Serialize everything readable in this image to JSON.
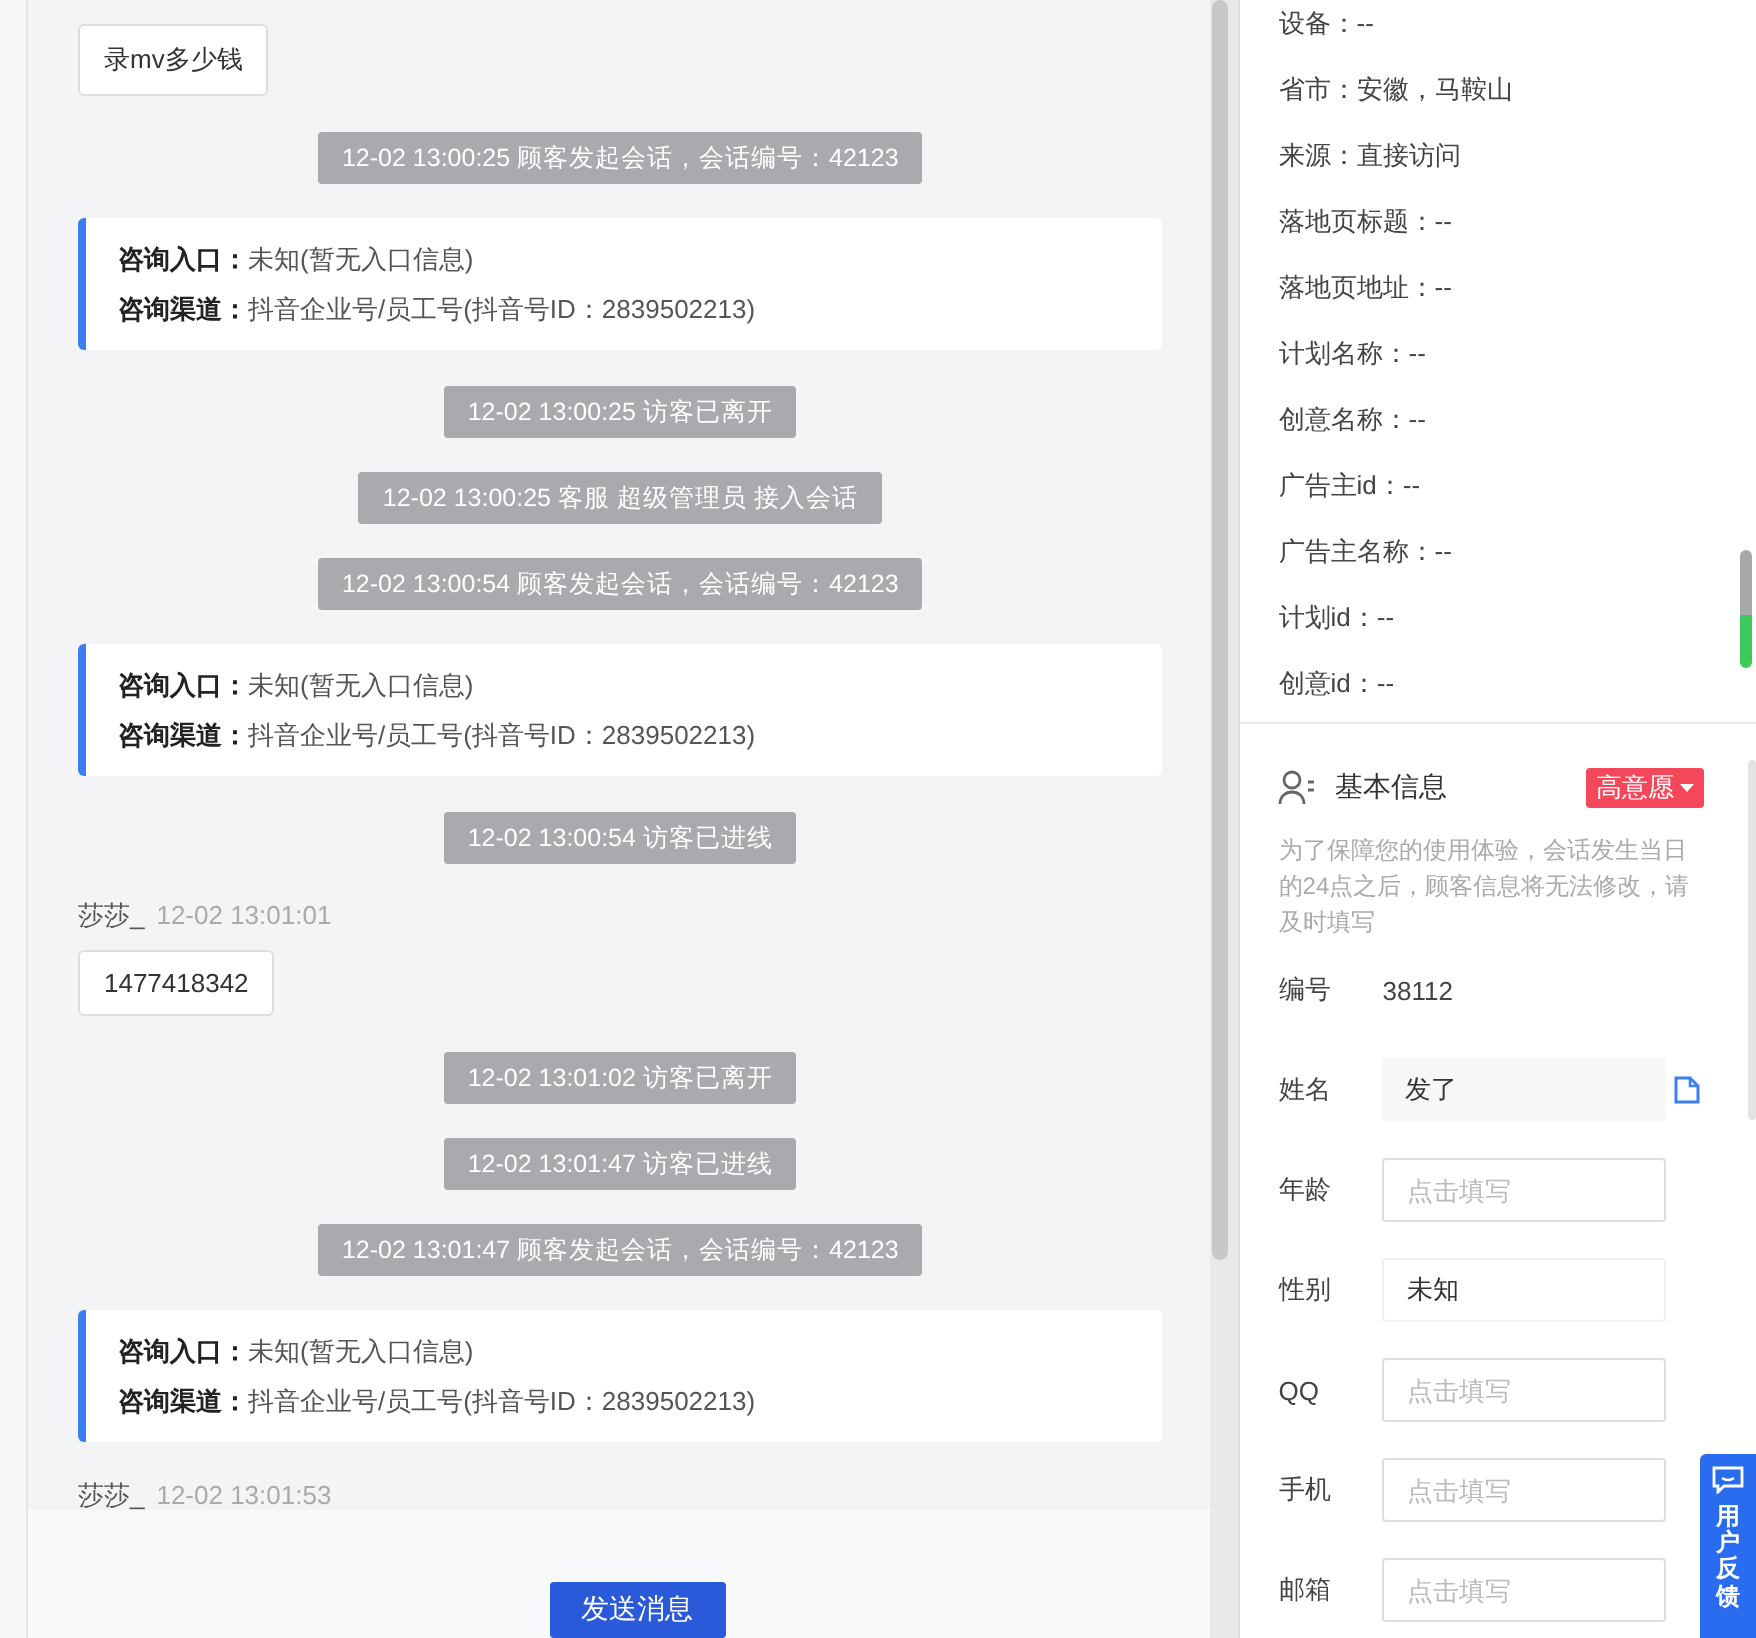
{
  "chat": {
    "items": [
      {
        "kind": "bubble",
        "text": "录mv多少钱"
      },
      {
        "kind": "system",
        "text": "12-02 13:00:25 顾客发起会话，会话编号：42123"
      },
      {
        "kind": "card",
        "lines": [
          {
            "label": "咨询入口：",
            "value": "未知(暂无入口信息)"
          },
          {
            "label": "咨询渠道：",
            "value": "抖音企业号/员工号(抖音号ID：2839502213)"
          }
        ]
      },
      {
        "kind": "system",
        "text": "12-02 13:00:25 访客已离开"
      },
      {
        "kind": "system",
        "text": "12-02 13:00:25 客服 超级管理员 接入会话"
      },
      {
        "kind": "system",
        "text": "12-02 13:00:54 顾客发起会话，会话编号：42123"
      },
      {
        "kind": "card",
        "lines": [
          {
            "label": "咨询入口：",
            "value": "未知(暂无入口信息)"
          },
          {
            "label": "咨询渠道：",
            "value": "抖音企业号/员工号(抖音号ID：2839502213)"
          }
        ]
      },
      {
        "kind": "system",
        "text": "12-02 13:00:54 访客已进线"
      },
      {
        "kind": "sender",
        "name": "莎莎_",
        "time": "12-02 13:01:01"
      },
      {
        "kind": "bubble",
        "text": "1477418342"
      },
      {
        "kind": "system",
        "text": "12-02 13:01:02 访客已离开"
      },
      {
        "kind": "system",
        "text": "12-02 13:01:47 访客已进线"
      },
      {
        "kind": "system",
        "text": "12-02 13:01:47 顾客发起会话，会话编号：42123"
      },
      {
        "kind": "card",
        "lines": [
          {
            "label": "咨询入口：",
            "value": "未知(暂无入口信息)"
          },
          {
            "label": "咨询渠道：",
            "value": "抖音企业号/员工号(抖音号ID：2839502213)"
          }
        ]
      },
      {
        "kind": "sender",
        "name": "莎莎_",
        "time": "12-02 13:01:53"
      }
    ],
    "send_button": "发送消息"
  },
  "visitor_info": [
    "设备：--",
    "省市：安徽，马鞍山",
    "来源：直接访问",
    "落地页标题：--",
    "落地页地址：--",
    "计划名称：--",
    "创意名称：--",
    "广告主id：--",
    "广告主名称：--",
    "计划id：--",
    "创意id：--"
  ],
  "basic_info": {
    "title": "基本信息",
    "tag": "高意愿",
    "note": "为了保障您的使用体验，会话发生当日的24点之后，顾客信息将无法修改，请及时填写",
    "fields": [
      {
        "kind": "text",
        "label": "编号",
        "value": "38112"
      },
      {
        "kind": "readonly",
        "label": "姓名",
        "value": "发了"
      },
      {
        "kind": "input",
        "label": "年龄",
        "placeholder": "点击填写"
      },
      {
        "kind": "select",
        "label": "性别",
        "value": "未知"
      },
      {
        "kind": "input",
        "label": "QQ",
        "placeholder": "点击填写"
      },
      {
        "kind": "input",
        "label": "手机",
        "placeholder": "点击填写"
      },
      {
        "kind": "input",
        "label": "邮箱",
        "placeholder": "点击填写"
      }
    ]
  },
  "feedback_button": "用户反馈"
}
